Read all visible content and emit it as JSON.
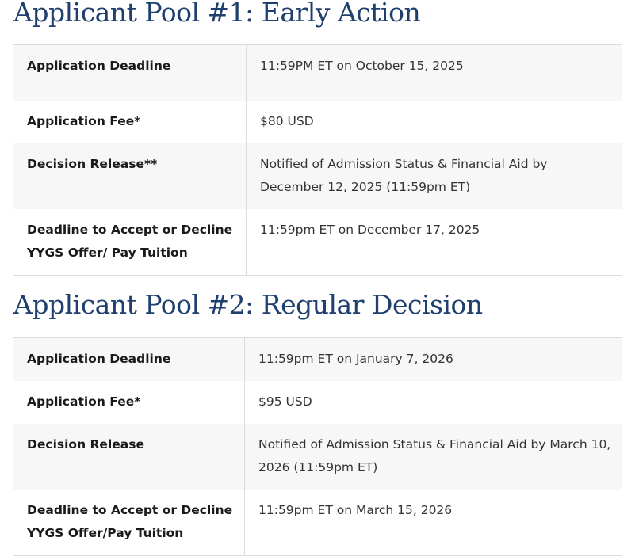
{
  "pool1": {
    "title": "Applicant Pool #1: Early Action",
    "rows": [
      {
        "label": "Application Deadline",
        "value": "11:59PM ET on October 15, 2025"
      },
      {
        "label": "Application Fee*",
        "value": "$80 USD"
      },
      {
        "label": "Decision Release**",
        "value_line1": "Notified of Admission Status & Financial Aid by",
        "value_line2": "December 12, 2025 (11:59pm ET)"
      },
      {
        "label_line1": "Deadline to Accept or Decline",
        "label_line2": "YYGS Offer/ Pay Tuition",
        "value": "11:59pm ET on December 17, 2025"
      }
    ]
  },
  "pool2": {
    "title": "Applicant Pool #2: Regular Decision",
    "rows": [
      {
        "label": "Application Deadline",
        "value": "11:59pm ET on January 7, 2026"
      },
      {
        "label": "Application Fee*",
        "value": "$95 USD"
      },
      {
        "label": "Decision Release",
        "value_line1": "Notified of Admission Status & Financial Aid by March 10,",
        "value_line2": "2026 (11:59pm ET)"
      },
      {
        "label_line1": "Deadline to Accept or Decline",
        "label_line2": "YYGS Offer/Pay Tuition",
        "value": "11:59pm ET on March 15, 2026"
      }
    ]
  }
}
